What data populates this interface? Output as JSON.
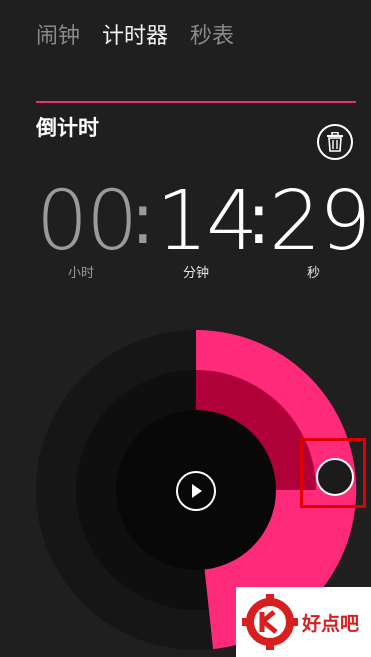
{
  "tabs": [
    {
      "label": "闹钟",
      "active": false
    },
    {
      "label": "计时器",
      "active": true
    },
    {
      "label": "秒表",
      "active": false
    }
  ],
  "section": {
    "title": "倒计时"
  },
  "timer": {
    "hours": "00",
    "minutes": "14",
    "seconds": "29",
    "separator": ":",
    "units": {
      "hours": "小时",
      "minutes": "分钟",
      "seconds": "秒"
    },
    "progress": {
      "minutes_fraction": 0.25,
      "seconds_fraction": 0.483
    }
  },
  "icons": {
    "delete": "trash-icon",
    "start": "play-icon"
  },
  "watermark": {
    "text": "好点吧"
  },
  "colors": {
    "accent": "#ff2a7a",
    "accent_dark": "#b0003a",
    "background": "#1f1f1f",
    "highlight": "#e00000"
  }
}
